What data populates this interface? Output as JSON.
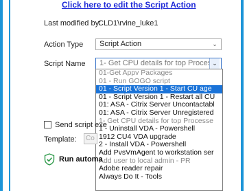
{
  "header": {
    "edit_link": "Click here to edit the Script Action"
  },
  "form": {
    "last_modified_label": "Last modified by:",
    "last_modified_value": "CLD1\\rvine_luke1",
    "action_type_label": "Action Type",
    "action_type_value": "Script Action",
    "script_name_label": "Script Name",
    "script_name_value": "1- Get CPU details for top Processe",
    "send_script_label": "Send script exe",
    "template_label": "Template:",
    "template_value": "Co",
    "run_label": "Run automa"
  },
  "dropdown": {
    "options": [
      {
        "label": "01-Get Appv Packages",
        "style": "dim"
      },
      {
        "label": "01 - Run GOGO script",
        "style": "dim"
      },
      {
        "label": "01 - Script Version 1 -  Start CU age",
        "style": "hl"
      },
      {
        "label": "01 - Script Version 1 - Restart all CU",
        "style": "normal"
      },
      {
        "label": "01: ASA - Citrix Server Uncontactabl",
        "style": "normal"
      },
      {
        "label": "01: ASA - Citrix Server Unregistered",
        "style": "normal"
      },
      {
        "label": "1- Get CPU details for top Processe",
        "style": "dim"
      },
      {
        "label": "1 - Uninstall VDA - Powershell",
        "style": "normal"
      },
      {
        "label": "1912 CU4 VDA upgrade",
        "style": "normal"
      },
      {
        "label": "2 - Install VDA - Powershell",
        "style": "normal"
      },
      {
        "label": "Add PvsVmAgent to workstation ser",
        "style": "normal"
      },
      {
        "label": "Add user to local admin - PR",
        "style": "dim"
      },
      {
        "label": "Adobe reader repair",
        "style": "normal"
      },
      {
        "label": "Always Do It - Tools",
        "style": "normal"
      }
    ]
  },
  "icons": {
    "dropdown_arrow": "chevron-down-icon",
    "run_icon": "shield-check-icon"
  },
  "colors": {
    "accent": "#1d95d8",
    "selection": "#1a73d8",
    "link": "#1f2ad8"
  }
}
